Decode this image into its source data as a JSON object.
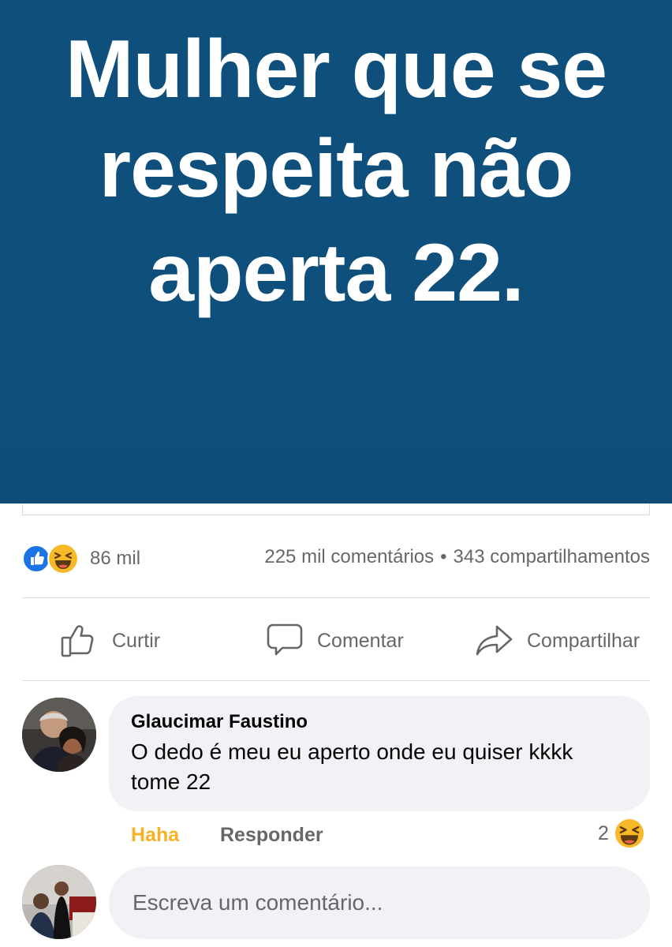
{
  "post": {
    "image_text_lines": [
      "Mulher que se",
      "respeita não",
      "aperta 22."
    ],
    "reaction_count": "86 mil",
    "comments_count": "225 mil comentários",
    "separator": "•",
    "shares_count": "343 compartilhamentos"
  },
  "actions": {
    "like_label": "Curtir",
    "comment_label": "Comentar",
    "share_label": "Compartilhar"
  },
  "comment": {
    "author": "Glaucimar Faustino",
    "text": "O dedo é meu eu aperto onde eu quiser kkkk tome 22",
    "haha_label": "Haha",
    "reply_label": "Responder",
    "reaction_count": "2"
  },
  "composer": {
    "placeholder": "Escreva um comentário..."
  },
  "colors": {
    "banner": "#0e4f7b",
    "like_blue": "#1b74e4",
    "haha_yellow": "#f7b125",
    "secondary_text": "#65676b",
    "bubble_bg": "#f0f2f5"
  },
  "icons": [
    "like-reaction-icon",
    "haha-reaction-icon",
    "thumbs-up-icon",
    "comment-icon",
    "share-arrow-icon"
  ]
}
